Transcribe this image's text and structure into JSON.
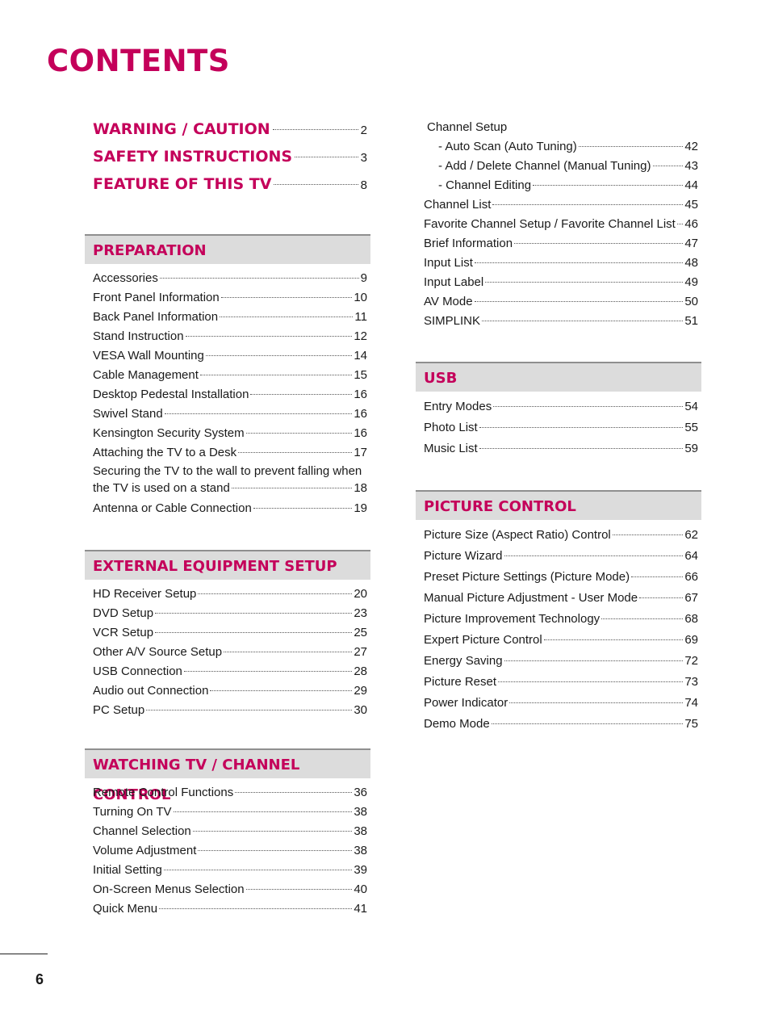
{
  "page_title": "CONTENTS",
  "page_number": "6",
  "top_entries": [
    {
      "label": "WARNING / CAUTION",
      "page": "2"
    },
    {
      "label": "SAFETY INSTRUCTIONS",
      "page": "3"
    },
    {
      "label": "FEATURE OF THIS TV",
      "page": "8"
    }
  ],
  "sections": {
    "preparation": {
      "title": "PREPARATION",
      "items": [
        {
          "label": "Accessories",
          "page": "9"
        },
        {
          "label": "Front Panel Information",
          "page": "10"
        },
        {
          "label": "Back Panel Information",
          "page": "11"
        },
        {
          "label": "Stand Instruction",
          "page": "12"
        },
        {
          "label": "VESA Wall Mounting",
          "page": "14"
        },
        {
          "label": "Cable Management",
          "page": "15"
        },
        {
          "label": "Desktop Pedestal Installation",
          "page": "16"
        },
        {
          "label": "Swivel Stand",
          "page": "16"
        },
        {
          "label": "Kensington Security System",
          "page": "16"
        },
        {
          "label": "Attaching the TV to a Desk",
          "page": "17"
        },
        {
          "label_line1": "Securing the TV to the wall to prevent falling when",
          "label": "the TV is used on a stand",
          "page": "18"
        },
        {
          "label": "Antenna or Cable Connection",
          "page": "19"
        }
      ]
    },
    "external": {
      "title": "EXTERNAL EQUIPMENT SETUP",
      "items": [
        {
          "label": "HD Receiver Setup",
          "page": "20"
        },
        {
          "label": "DVD Setup",
          "page": "23"
        },
        {
          "label": "VCR Setup",
          "page": "25"
        },
        {
          "label": "Other A/V Source Setup",
          "page": "27"
        },
        {
          "label": "USB Connection",
          "page": "28"
        },
        {
          "label": "Audio out Connection",
          "page": "29"
        },
        {
          "label": "PC Setup",
          "page": "30"
        }
      ]
    },
    "watching": {
      "title": "WATCHING TV / CHANNEL CONTROL",
      "items": [
        {
          "label": "Remote Control Functions",
          "page": "36"
        },
        {
          "label": "Turning On TV",
          "page": "38"
        },
        {
          "label": "Channel Selection",
          "page": "38"
        },
        {
          "label": "Volume Adjustment",
          "page": "38"
        },
        {
          "label": "Initial Setting",
          "page": "39"
        },
        {
          "label": "On-Screen Menus Selection",
          "page": "40"
        },
        {
          "label": "Quick Menu",
          "page": "41"
        }
      ]
    },
    "channel": {
      "heading": "Channel Setup",
      "sub_items": [
        {
          "label": "- Auto Scan (Auto Tuning)",
          "page": "42"
        },
        {
          "label": "- Add / Delete Channel (Manual Tuning)",
          "page": "43"
        },
        {
          "label": "- Channel Editing",
          "page": "44"
        }
      ],
      "items": [
        {
          "label": "Channel List",
          "page": "45"
        },
        {
          "label": "Favorite Channel Setup / Favorite Channel List",
          "page": "46"
        },
        {
          "label": "Brief Information",
          "page": "47"
        },
        {
          "label": "Input List",
          "page": "48"
        },
        {
          "label": "Input Label",
          "page": "49"
        },
        {
          "label": "AV Mode",
          "page": "50"
        },
        {
          "label": "SIMPLINK",
          "page": "51"
        }
      ]
    },
    "usb": {
      "title": "USB",
      "items": [
        {
          "label": "Entry Modes",
          "page": "54"
        },
        {
          "label": "Photo List",
          "page": "55"
        },
        {
          "label": "Music List",
          "page": "59"
        }
      ]
    },
    "picture": {
      "title": "PICTURE CONTROL",
      "items": [
        {
          "label": "Picture Size (Aspect Ratio) Control",
          "page": "62"
        },
        {
          "label": "Picture Wizard",
          "page": "64"
        },
        {
          "label": "Preset Picture Settings (Picture Mode)",
          "page": "66"
        },
        {
          "label": "Manual Picture Adjustment - User Mode",
          "page": "67"
        },
        {
          "label": "Picture Improvement Technology",
          "page": "68"
        },
        {
          "label": "Expert Picture Control",
          "page": "69"
        },
        {
          "label": "Energy Saving",
          "page": "72"
        },
        {
          "label": "Picture Reset",
          "page": "73"
        },
        {
          "label": "Power Indicator",
          "page": "74"
        },
        {
          "label": "Demo Mode",
          "page": "75"
        }
      ]
    }
  },
  "colors": {
    "accent": "#c4005a",
    "header_band": "#dcdcdc"
  }
}
